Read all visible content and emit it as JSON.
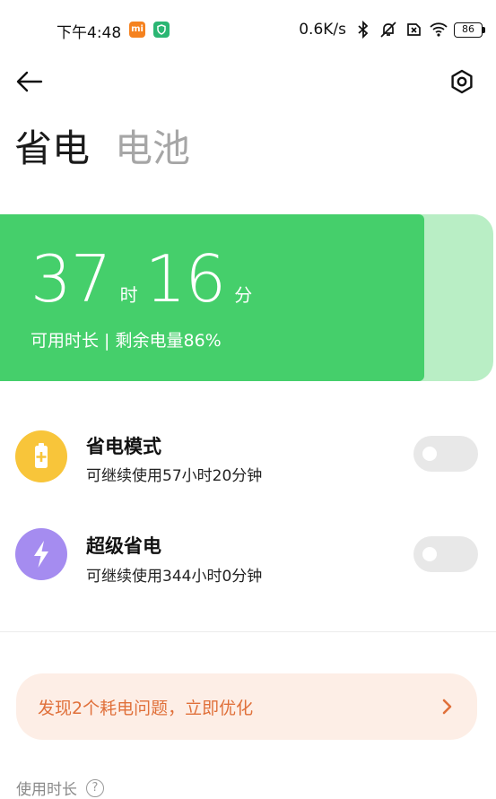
{
  "status_bar": {
    "time": "下午4:48",
    "mi_badge": "mi",
    "net_speed": "0.6K/s",
    "battery_level": "86"
  },
  "tabs": [
    {
      "label": "省电",
      "active": true
    },
    {
      "label": "电池",
      "active": false
    }
  ],
  "battery_card": {
    "hours": "37",
    "hours_unit": "时",
    "minutes": "16",
    "minutes_unit": "分",
    "subtitle": "可用时长 | 剩余电量86%",
    "remaining_percent": 86,
    "fill_color": "#45cf6b",
    "track_color": "#b9eec5"
  },
  "modes": [
    {
      "title": "省电模式",
      "desc": "可继续使用57小时20分钟",
      "icon": "battery-plus-icon",
      "icon_color": "#f8c53a",
      "enabled": false
    },
    {
      "title": "超级省电",
      "desc": "可继续使用344小时0分钟",
      "icon": "lightning-icon",
      "icon_color": "#a58cf0",
      "enabled": false
    }
  ],
  "optimize": {
    "text": "发现2个耗电问题，立即优化",
    "color": "#e0703a"
  },
  "usage": {
    "label": "使用时长",
    "help": "?"
  }
}
